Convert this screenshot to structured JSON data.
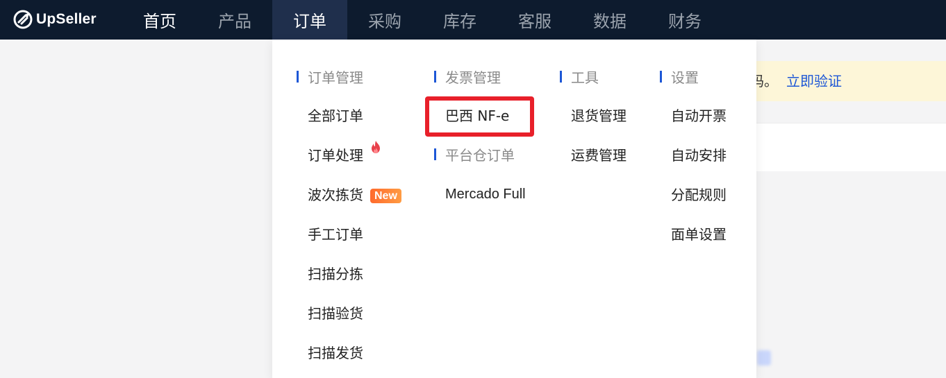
{
  "brand": {
    "name": "UpSeller"
  },
  "nav": [
    {
      "label": "首页",
      "state": "white"
    },
    {
      "label": "产品",
      "state": "normal"
    },
    {
      "label": "订单",
      "state": "active"
    },
    {
      "label": "采购",
      "state": "normal"
    },
    {
      "label": "库存",
      "state": "normal"
    },
    {
      "label": "客服",
      "state": "normal"
    },
    {
      "label": "数据",
      "state": "normal"
    },
    {
      "label": "财务",
      "state": "normal"
    }
  ],
  "banner": {
    "text_fragment": "码。",
    "link": "立即验证"
  },
  "dropdown": {
    "columns": [
      {
        "title": "订单管理",
        "items": [
          {
            "label": "全部订单"
          },
          {
            "label": "订单处理",
            "icon": "fire-icon"
          },
          {
            "label": "波次拣货",
            "badge": "New"
          },
          {
            "label": "手工订单"
          },
          {
            "label": "扫描分拣"
          },
          {
            "label": "扫描验货"
          },
          {
            "label": "扫描发货"
          }
        ]
      },
      {
        "title": "发票管理",
        "items": [
          {
            "label": "巴西 NF-e",
            "highlighted": true
          }
        ],
        "sub_title": "平台仓订单",
        "sub_items": [
          {
            "label": "Mercado Full"
          }
        ]
      },
      {
        "title": "工具",
        "items": [
          {
            "label": "退货管理"
          },
          {
            "label": "运费管理"
          }
        ]
      },
      {
        "title": "设置",
        "items": [
          {
            "label": "自动开票"
          },
          {
            "label": "自动安排"
          },
          {
            "label": "分配规则"
          },
          {
            "label": "面单设置"
          }
        ]
      }
    ]
  },
  "colors": {
    "nav_bg": "#0d1b2e",
    "nav_active_bg": "#1f2f4c",
    "accent": "#1d57d6",
    "highlight": "#e8202a",
    "badge": "#ff7a30",
    "fire": "#e8414b"
  }
}
